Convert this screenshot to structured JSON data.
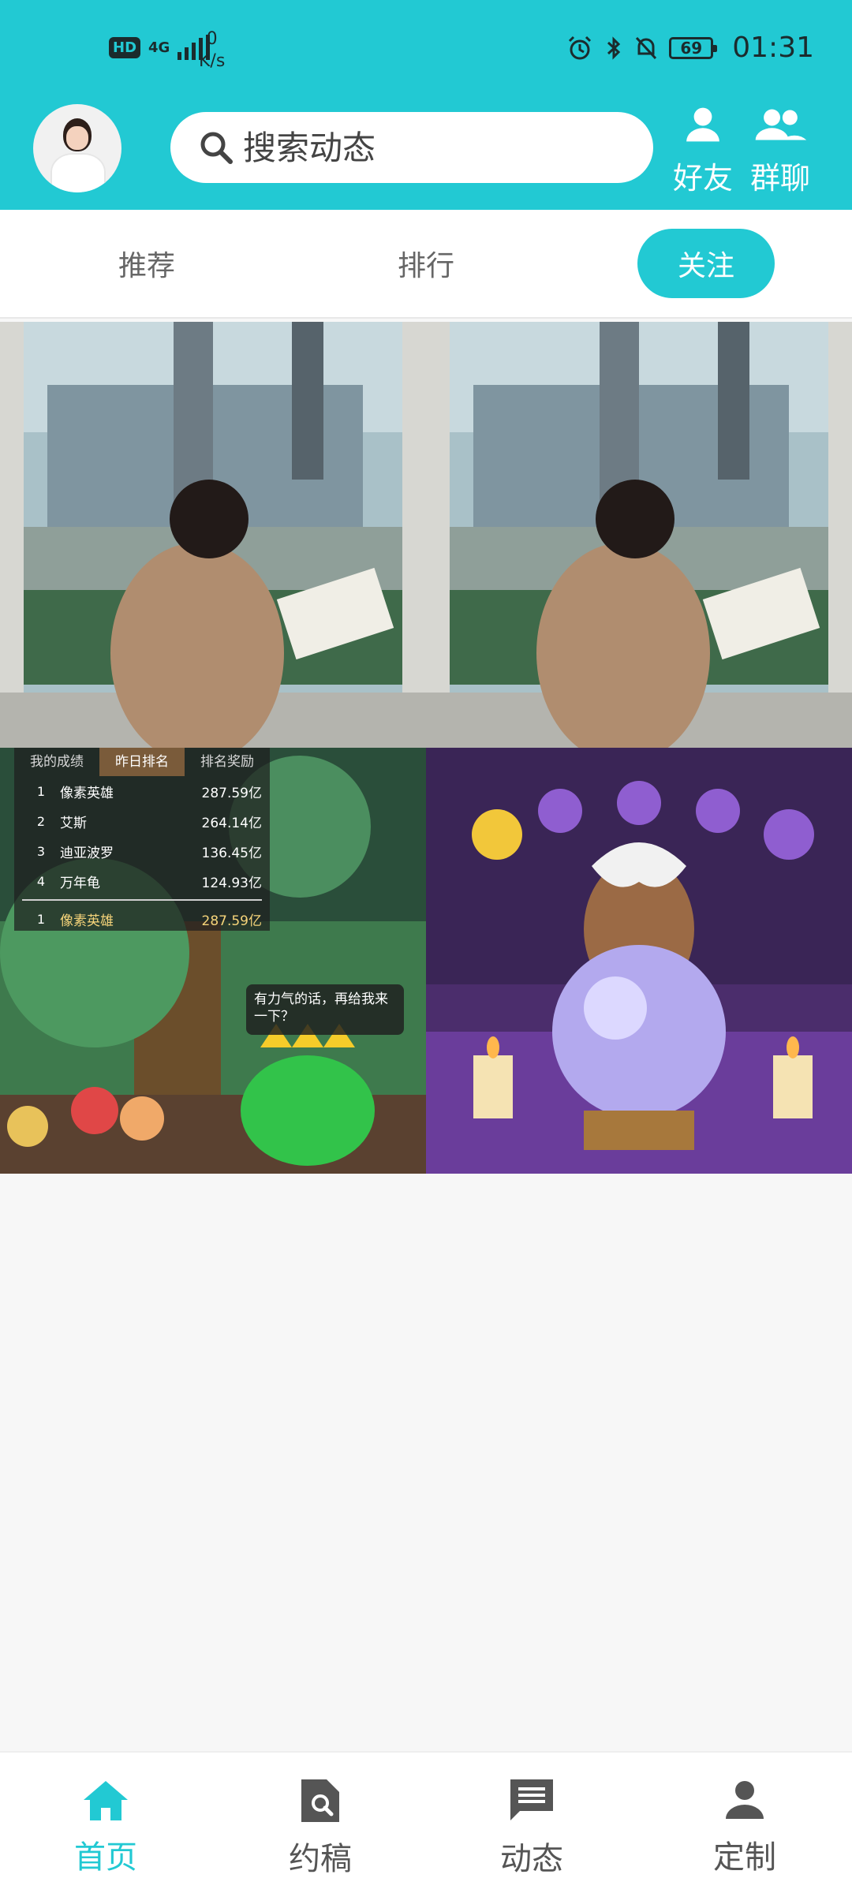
{
  "status_bar": {
    "hd": "HD",
    "network": "4G",
    "speed_value": "0",
    "speed_unit": "K/s",
    "battery": "69",
    "time": "01:31"
  },
  "header": {
    "search_placeholder": "搜索动态",
    "friends_label": "好友",
    "group_chat_label": "群聊",
    "accent": "#22c9d3"
  },
  "tabs": [
    {
      "label": "推荐"
    },
    {
      "label": "排行"
    },
    {
      "label": "关注",
      "active": true
    }
  ],
  "game_leaderboard": {
    "tabs": [
      "我的成绩",
      "昨日排名",
      "排名奖励"
    ],
    "rows": [
      {
        "rank": "1",
        "name": "像素英雄",
        "value": "287.59亿"
      },
      {
        "rank": "2",
        "name": "艾斯",
        "value": "264.14亿"
      },
      {
        "rank": "3",
        "name": "迪亚波罗",
        "value": "136.45亿"
      },
      {
        "rank": "4",
        "name": "万年龟",
        "value": "124.93亿"
      }
    ],
    "me": {
      "rank": "1",
      "name": "像素英雄",
      "value": "287.59亿"
    },
    "speech": "有力气的话，再给我来一下？"
  },
  "bottom_nav": [
    {
      "label": "首页",
      "icon": "home-icon",
      "active": true
    },
    {
      "label": "约稿",
      "icon": "document-search-icon"
    },
    {
      "label": "动态",
      "icon": "message-icon"
    },
    {
      "label": "定制",
      "icon": "person-icon"
    }
  ]
}
